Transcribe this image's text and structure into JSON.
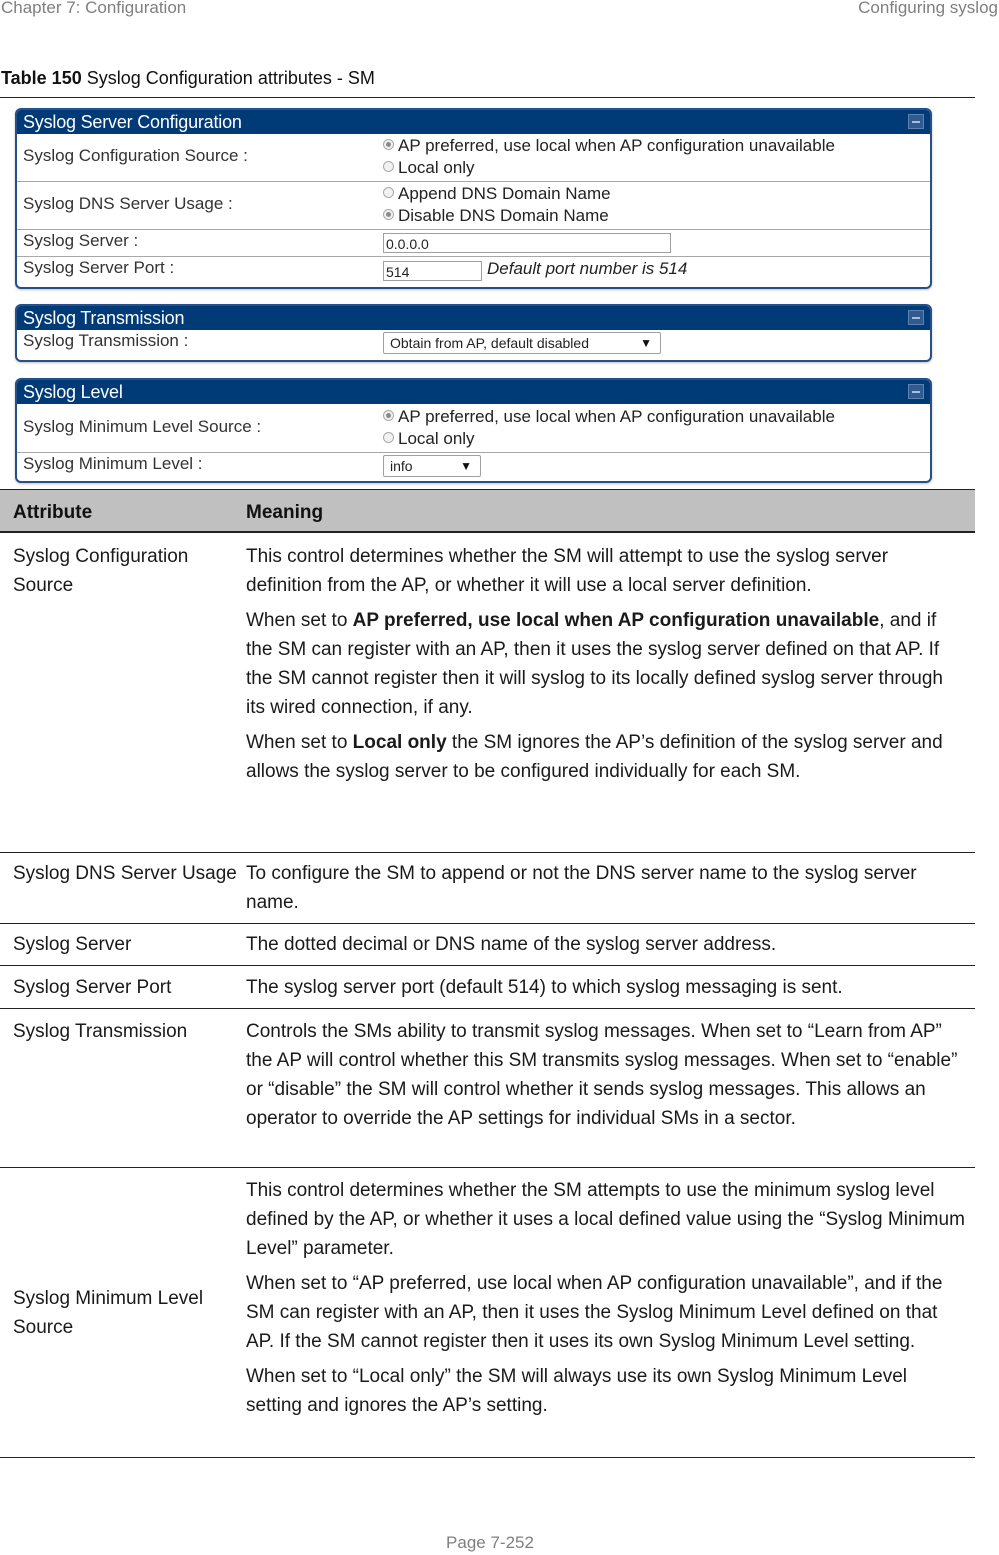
{
  "header": {
    "chapter": "Chapter 7:  Configuration",
    "section": "Configuring syslog"
  },
  "caption": {
    "number": "Table 150",
    "title": " Syslog Configuration attributes - SM"
  },
  "panels": {
    "server_config": {
      "title": "Syslog Server Configuration",
      "rows": {
        "config_source": {
          "label": "Syslog Configuration Source :",
          "options": [
            "AP preferred, use local when AP configuration unavailable",
            "Local only"
          ],
          "selected": "AP preferred, use local when AP configuration unavailable"
        },
        "dns_usage": {
          "label": "Syslog DNS Server Usage :",
          "options": [
            "Append DNS Domain Name",
            "Disable DNS Domain Name"
          ],
          "selected": "Disable DNS Domain Name"
        },
        "server": {
          "label": "Syslog Server :",
          "value": "0.0.0.0"
        },
        "port": {
          "label": "Syslog Server Port :",
          "value": "514",
          "hint": "Default port number is 514"
        }
      }
    },
    "transmission": {
      "title": "Syslog Transmission",
      "rows": {
        "transmission": {
          "label": "Syslog Transmission :",
          "selected": "Obtain from AP, default disabled"
        }
      }
    },
    "level": {
      "title": "Syslog Level",
      "rows": {
        "level_source": {
          "label": "Syslog Minimum Level Source :",
          "options": [
            "AP preferred, use local when AP configuration unavailable",
            "Local only"
          ],
          "selected": "AP preferred, use local when AP configuration unavailable"
        },
        "min_level": {
          "label": "Syslog Minimum Level :",
          "selected": "info"
        }
      }
    }
  },
  "table": {
    "headers": [
      "Attribute",
      "Meaning"
    ],
    "rows": [
      {
        "attribute": "Syslog Configuration Source",
        "meaning": [
          {
            "text": "This control determines whether the SM will attempt to use the syslog server definition from the AP, or whether it will use a local server definition."
          },
          {
            "pre": "When set to ",
            "bold": "AP preferred, use local when AP configuration unavailable",
            "post": ", and if the SM can register with an AP, then it uses the syslog server defined on that AP. If the SM cannot register then it will syslog to its locally defined syslog server through its wired connection, if any."
          },
          {
            "pre": "When set to ",
            "bold": "Local only",
            "post": " the SM ignores the AP’s definition of the syslog server and allows the syslog server to be configured individually for each SM."
          }
        ]
      },
      {
        "attribute": "Syslog DNS Server Usage",
        "meaning": [
          {
            "text": "To configure the SM to append or not the DNS server name to the syslog server name."
          }
        ]
      },
      {
        "attribute": "Syslog Server",
        "meaning": [
          {
            "text": "The dotted decimal or DNS name of the syslog server address."
          }
        ]
      },
      {
        "attribute": "Syslog Server Port",
        "meaning": [
          {
            "text": "The syslog server port (default 514) to which syslog messaging is sent."
          }
        ]
      },
      {
        "attribute": "Syslog Transmission",
        "meaning": [
          {
            "text": "Controls the SMs ability to transmit syslog messages. When set to “Learn from AP” the AP will control whether this SM transmits syslog messages. When set to “enable” or “disable” the SM will control whether it sends syslog messages. This allows an operator to override the AP settings for individual SMs in a sector."
          }
        ]
      },
      {
        "attribute": "Syslog Minimum Level Source",
        "meaning": [
          {
            "text": "This control determines whether the SM attempts to use the minimum syslog level defined by the AP, or whether it uses a local defined value using the “Syslog Minimum Level” parameter."
          },
          {
            "text": "When set to “AP preferred, use local when AP configuration unavailable”, and if the SM can register with an AP, then it uses the Syslog Minimum Level defined on that AP. If the SM cannot register then it uses its own Syslog Minimum Level setting."
          },
          {
            "text": "When set to “Local only” the SM will always use its own Syslog Minimum Level setting and ignores the AP’s setting."
          }
        ]
      }
    ]
  },
  "footer": {
    "page": "Page 7-252"
  },
  "colors": {
    "panel_header": "#003b78",
    "table_header": "#c0c0c0",
    "running_text": "#7f7f7f"
  }
}
